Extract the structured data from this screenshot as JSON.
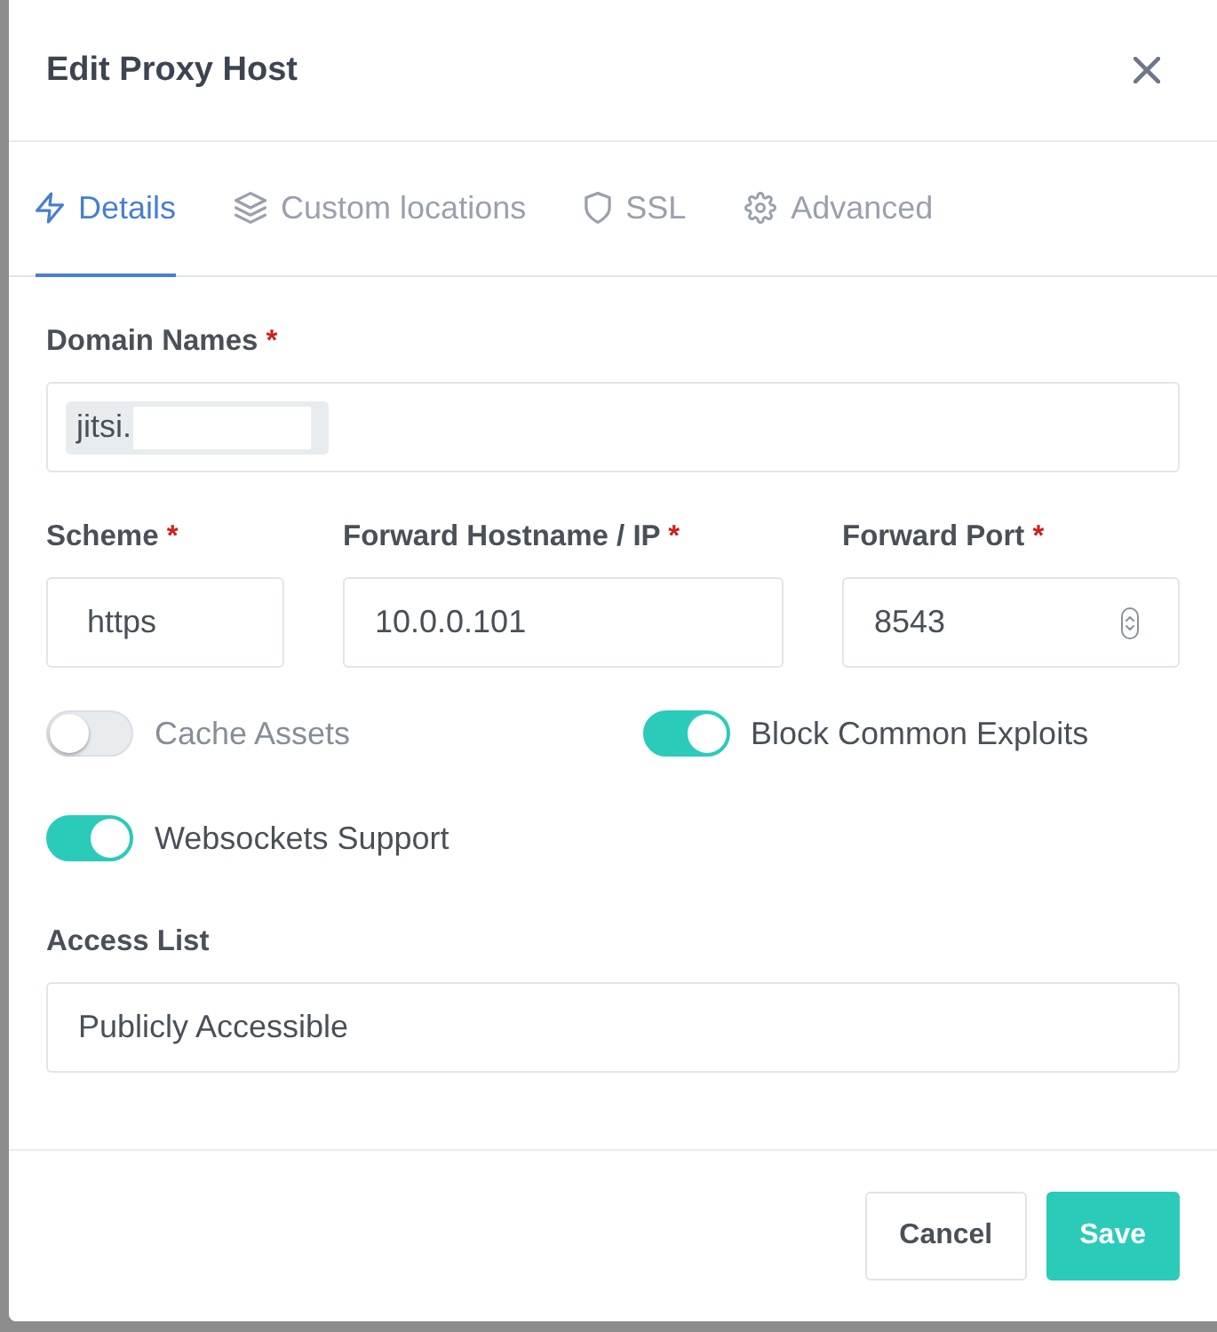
{
  "dialog": {
    "title": "Edit Proxy Host"
  },
  "tabs": [
    {
      "label": "Details",
      "selected": true
    },
    {
      "label": "Custom locations",
      "selected": false
    },
    {
      "label": "SSL",
      "selected": false
    },
    {
      "label": "Advanced",
      "selected": false
    }
  ],
  "domain_names": {
    "label": "Domain Names",
    "required_mark": "*",
    "tags": [
      {
        "text": "jitsi.",
        "redacted": true
      }
    ]
  },
  "forward_fields": [
    {
      "kind": "select",
      "label": "Scheme",
      "required_mark": "*",
      "value": "https"
    },
    {
      "kind": "text",
      "label": "Forward Hostname / IP",
      "required_mark": "*",
      "value": "10.0.0.101"
    },
    {
      "kind": "number",
      "label": "Forward Port",
      "required_mark": "*",
      "value": "8543"
    }
  ],
  "toggles": [
    {
      "label": "Cache Assets",
      "on": false
    },
    {
      "label": "Block Common Exploits",
      "on": true
    },
    {
      "label": "Websockets Support",
      "on": true
    }
  ],
  "access_list": {
    "label": "Access List",
    "value": "Publicly Accessible"
  },
  "buttons": [
    {
      "kind": "secondary",
      "label": "Cancel"
    },
    {
      "kind": "primary",
      "label": "Save"
    }
  ]
}
